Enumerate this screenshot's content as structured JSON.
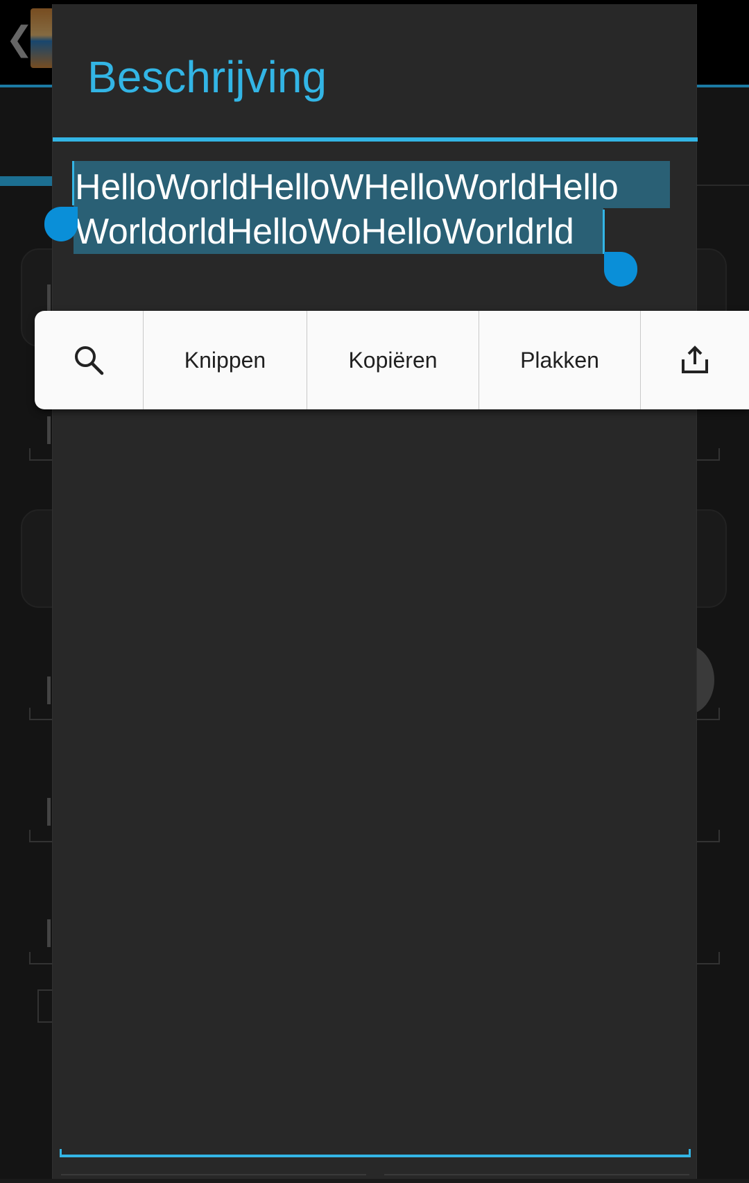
{
  "dialog": {
    "title": "Beschrijving",
    "text_line_1": "HelloWorldHelloWHelloWorldHello",
    "text_line_2": "WorldorldHelloWoHelloWorldrld"
  },
  "toolbar": {
    "items": [
      {
        "type": "icon",
        "icon": "search-icon"
      },
      {
        "type": "text",
        "label": "Knippen"
      },
      {
        "type": "text",
        "label": "Kopiëren"
      },
      {
        "type": "text",
        "label": "Plakken"
      },
      {
        "type": "icon",
        "icon": "share-icon"
      }
    ]
  },
  "colors": {
    "accent": "#33b5e5",
    "selection": "#2a6075",
    "handle": "#0a8fd8",
    "dialog_bg": "#282828",
    "toolbar_bg": "#fafafa"
  }
}
